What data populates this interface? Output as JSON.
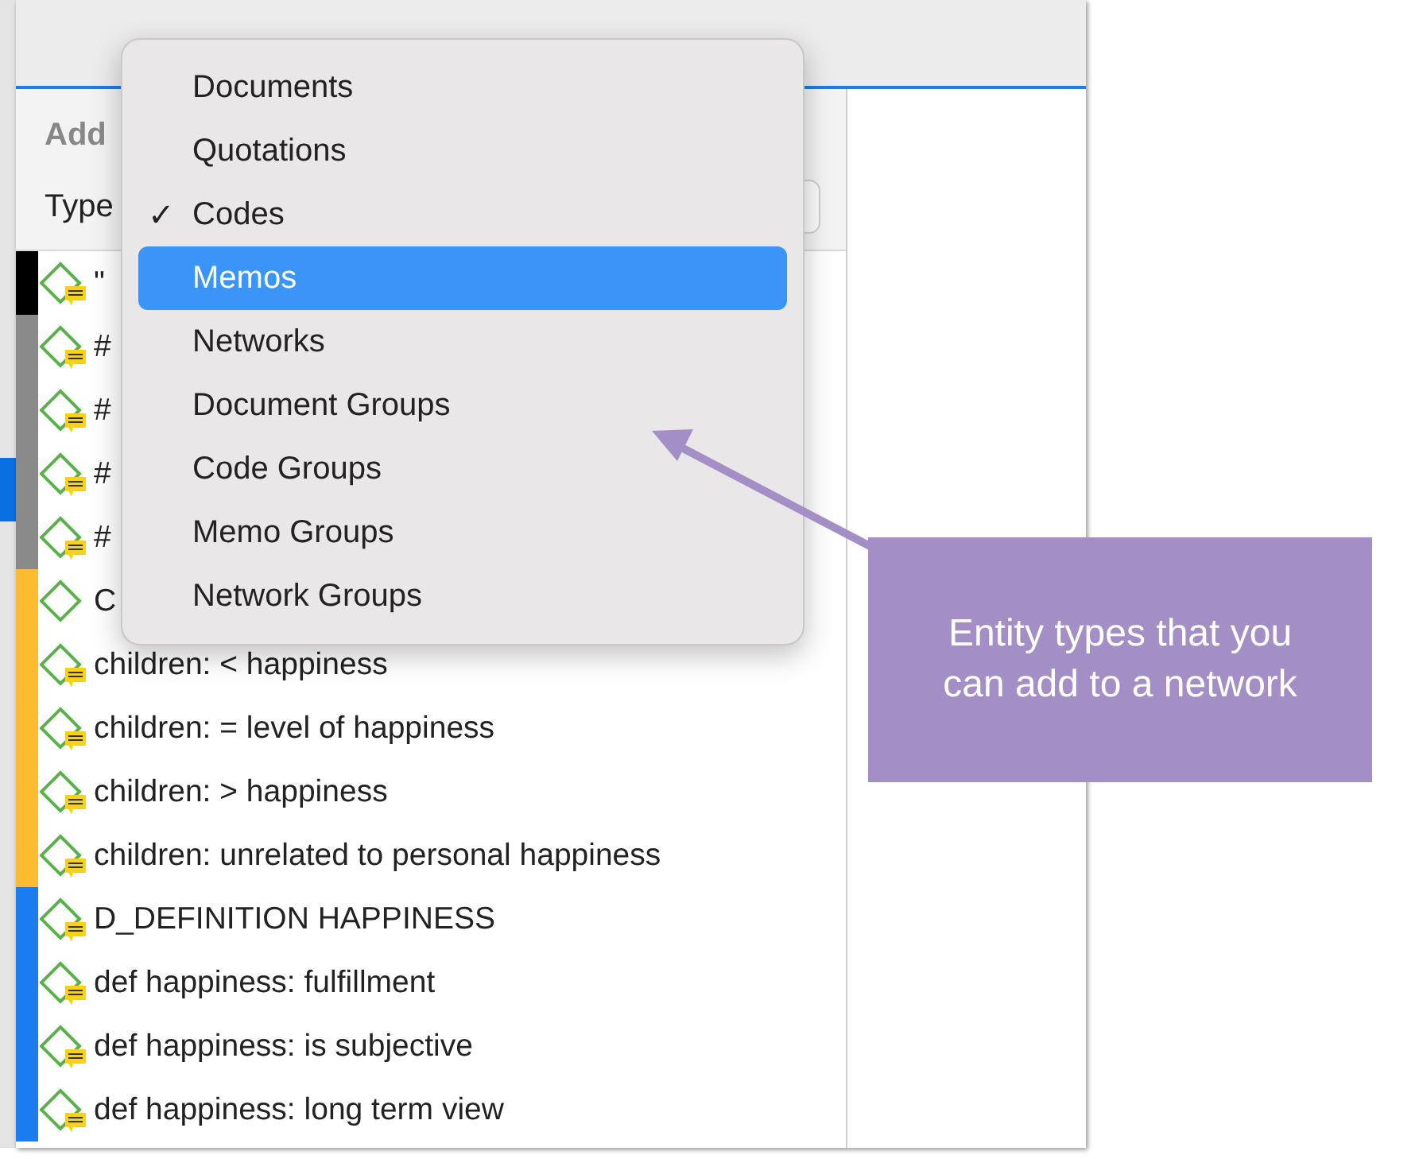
{
  "panel": {
    "heading": "Add",
    "type_label": "Type"
  },
  "rows": [
    {
      "label": "\"",
      "color": "#000000",
      "has_memo": true
    },
    {
      "label": "#",
      "color": "#8a8a8a",
      "has_memo": true
    },
    {
      "label": "#",
      "color": "#8a8a8a",
      "has_memo": true
    },
    {
      "label": "#",
      "color": "#8a8a8a",
      "has_memo": true
    },
    {
      "label": "#",
      "color": "#8a8a8a",
      "has_memo": true
    },
    {
      "label": "C",
      "color": "#fdbb2f",
      "has_memo": false
    },
    {
      "label": "children: < happiness",
      "color": "#fdbb2f",
      "has_memo": true
    },
    {
      "label": "children: = level of happiness",
      "color": "#fdbb2f",
      "has_memo": true
    },
    {
      "label": "children: > happiness",
      "color": "#fdbb2f",
      "has_memo": true
    },
    {
      "label": "children: unrelated to personal happiness",
      "color": "#fdbb2f",
      "has_memo": true
    },
    {
      "label": "D_DEFINITION HAPPINESS",
      "color": "#1a7cf0",
      "has_memo": true
    },
    {
      "label": "def happiness: fulfillment",
      "color": "#1a7cf0",
      "has_memo": true
    },
    {
      "label": "def happiness: is subjective",
      "color": "#1a7cf0",
      "has_memo": true
    },
    {
      "label": "def happiness: long term view",
      "color": "#1a7cf0",
      "has_memo": true
    }
  ],
  "menu": [
    {
      "label": "Documents",
      "checked": false,
      "selected": false
    },
    {
      "label": "Quotations",
      "checked": false,
      "selected": false
    },
    {
      "label": "Codes",
      "checked": true,
      "selected": false
    },
    {
      "label": "Memos",
      "checked": false,
      "selected": true
    },
    {
      "label": "Networks",
      "checked": false,
      "selected": false
    },
    {
      "label": "Document Groups",
      "checked": false,
      "selected": false
    },
    {
      "label": "Code Groups",
      "checked": false,
      "selected": false
    },
    {
      "label": "Memo Groups",
      "checked": false,
      "selected": false
    },
    {
      "label": "Network Groups",
      "checked": false,
      "selected": false
    }
  ],
  "menu_check_glyph": "✓",
  "callout": {
    "text": "Entity types that you can add to a network"
  }
}
